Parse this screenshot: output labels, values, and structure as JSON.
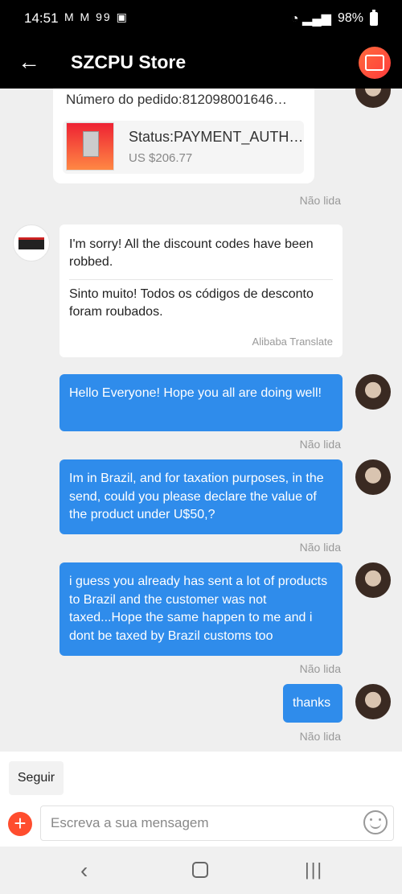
{
  "status_bar": {
    "time": "14:51",
    "notification_icons": "M M 99 ▣",
    "battery": "98%"
  },
  "app_bar": {
    "title": "SZCPU Store"
  },
  "order": {
    "number": "Número do pedido:812098001646…",
    "status": "Status:PAYMENT_AUTH…",
    "price": "US $206.77"
  },
  "read_status": "Não lida",
  "store_message": {
    "original": "I'm sorry! All the discount codes have been robbed.",
    "translation": "Sinto muito! Todos os códigos de desconto foram roubados.",
    "translator": "Alibaba Translate"
  },
  "messages": [
    {
      "text": "Hello Everyone! Hope  you all are doing well!",
      "status": "Não lida"
    },
    {
      "text": "Im in Brazil,  and  for taxation purposes, in the send, could you please declare the value  of the product  under U$50,?",
      "status": "Não lida"
    },
    {
      "text": "i guess  you already  has sent a lot  of products to Brazil  and the customer  was not taxed...Hope the same happen to me and i dont  be taxed  by Brazil customs  too",
      "status": "Não lida"
    },
    {
      "text": "thanks",
      "status": "Não lida"
    }
  ],
  "compose": {
    "follow_label": "Seguir",
    "placeholder": "Escreva a sua mensagem"
  },
  "colors": {
    "bubble": "#2f8ceb",
    "accent": "#ff4d2e",
    "app_bar": "#000000",
    "background": "#efefef"
  },
  "icons": [
    "back-arrow-icon",
    "store-icon",
    "plus-icon",
    "emoji-icon",
    "nav-back-icon",
    "nav-home-icon",
    "nav-recent-icon"
  ]
}
